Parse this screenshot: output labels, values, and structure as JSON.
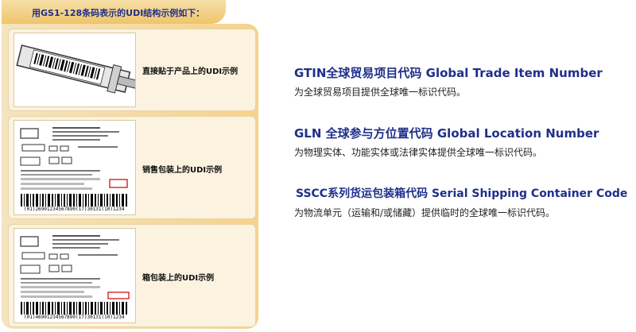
{
  "header": {
    "title": "用GS1-128条码表示的UDI结构示例如下："
  },
  "examples": [
    {
      "label": "直接贴于产品上的UDI示例",
      "icon": "syringe-label-illustration"
    },
    {
      "label": "销售包装上的UDI示例",
      "icon": "sales-package-label-illustration",
      "hri": "(01)26901234567890(17)30131(10)1234"
    },
    {
      "label": "箱包装上的UDI示例",
      "icon": "case-package-label-illustration",
      "hri": "(01)46901234567890(17)30131(10)1234"
    }
  ],
  "definitions": [
    {
      "title": "GTIN全球贸易项目代码 Global Trade Item Number",
      "desc": "为全球贸易项目提供全球唯一标识代码。"
    },
    {
      "title": "GLN 全球参与方位置代码 Global Location Number",
      "desc": "为物理实体、功能实体或法律实体提供全球唯一标识代码。"
    },
    {
      "title": "SSCC系列货运包装箱代码 Serial Shipping Container Code",
      "desc": "为物流单元（运输和/或储藏）提供临时的全球唯一标识代码。"
    }
  ],
  "colors": {
    "title_blue": "#1f2f8a",
    "panel_orange": "#efc46a",
    "panel_light": "#f4e4c0"
  }
}
